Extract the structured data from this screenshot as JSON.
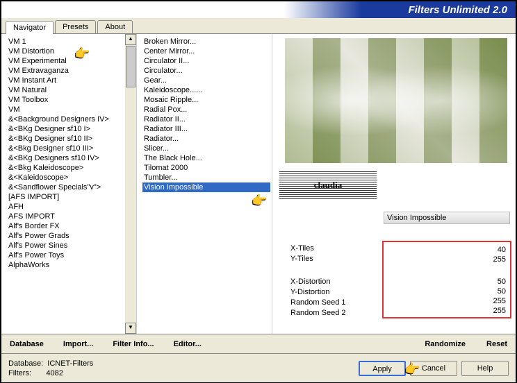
{
  "header": {
    "title": "Filters Unlimited 2.0"
  },
  "tabs": {
    "navigator": "Navigator",
    "presets": "Presets",
    "about": "About"
  },
  "categories": [
    "VM 1",
    "VM Distortion",
    "VM Experimental",
    "VM Extravaganza",
    "VM Instant Art",
    "VM Natural",
    "VM Toolbox",
    "VM",
    "&<Background Designers IV>",
    "&<BKg Designer sf10 I>",
    "&<BKg Designer sf10 II>",
    "&<Bkg Designer sf10 III>",
    "&<BKg Designers sf10 IV>",
    "&<Bkg Kaleidoscope>",
    "&<Kaleidoscope>",
    "&<Sandflower Specials\"v\">",
    "[AFS IMPORT]",
    "AFH",
    "AFS IMPORT",
    "Alf's Border FX",
    "Alf's Power Grads",
    "Alf's Power Sines",
    "Alf's Power Toys",
    "AlphaWorks"
  ],
  "filters": [
    "Broken Mirror...",
    "Center Mirror...",
    "Circulator II...",
    "Circulator...",
    "Gear...",
    "Kaleidoscope......",
    "Mosaic Ripple...",
    "Radial Pox...",
    "Radiator II...",
    "Radiator III...",
    "Radiator...",
    "Slicer...",
    "The Black Hole...",
    "Tilomat 2000",
    "Tumbler...",
    "Vision Impossible"
  ],
  "stamp": "claudia",
  "filter_name": "Vision Impossible",
  "params": {
    "xtiles": {
      "label": "X-Tiles",
      "value": "40"
    },
    "ytiles": {
      "label": "Y-Tiles",
      "value": "255"
    },
    "xdist": {
      "label": "X-Distortion",
      "value": "50"
    },
    "ydist": {
      "label": "Y-Distortion",
      "value": "50"
    },
    "rs1": {
      "label": "Random Seed 1",
      "value": "255"
    },
    "rs2": {
      "label": "Random Seed 2",
      "value": "255"
    }
  },
  "toolbar": {
    "database": "Database",
    "import": "Import...",
    "filterinfo": "Filter Info...",
    "editor": "Editor...",
    "randomize": "Randomize",
    "reset": "Reset"
  },
  "footer": {
    "db_label": "Database:",
    "db_value": "ICNET-Filters",
    "filters_label": "Filters:",
    "filters_value": "4082",
    "apply": "Apply",
    "cancel": "Cancel",
    "help": "Help"
  }
}
